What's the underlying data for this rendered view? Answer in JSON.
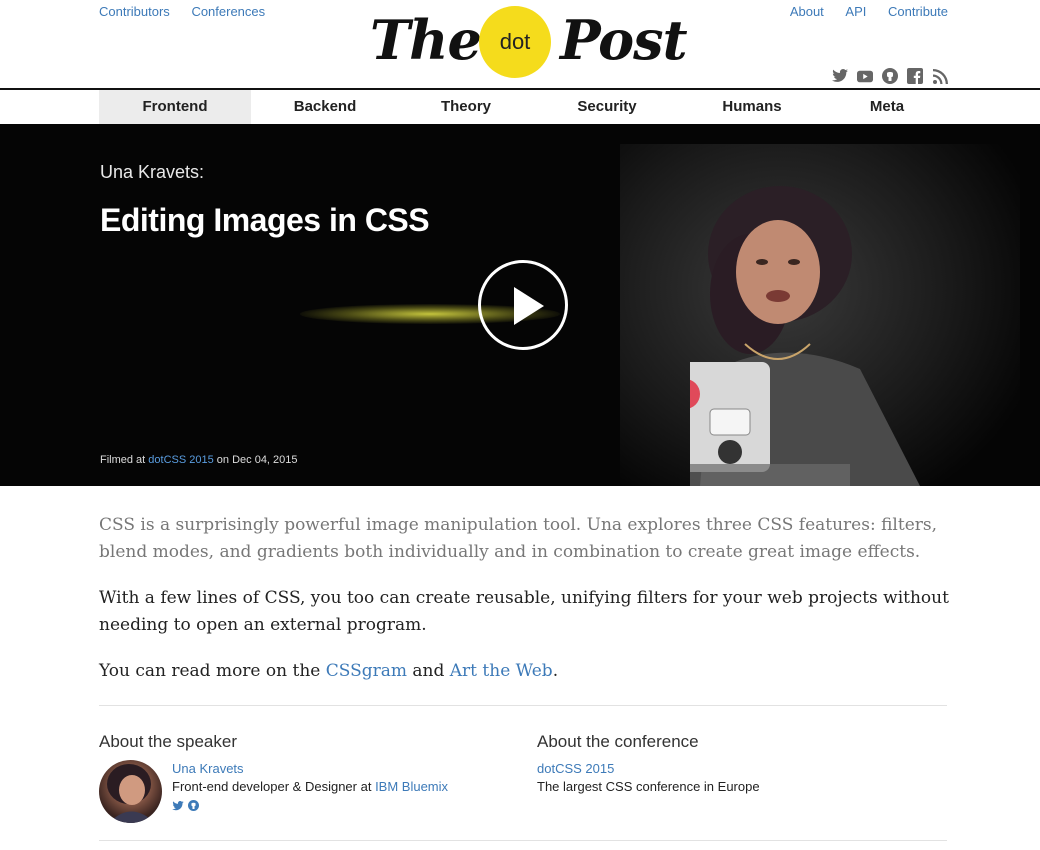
{
  "header": {
    "left_links": [
      "Contributors",
      "Conferences"
    ],
    "right_links": [
      "About",
      "API",
      "Contribute"
    ],
    "logo": {
      "word1": "The",
      "dot": "dot",
      "word2": "Post"
    },
    "social_icons": [
      "twitter-icon",
      "youtube-icon",
      "github-icon",
      "facebook-icon",
      "rss-icon"
    ]
  },
  "nav": {
    "items": [
      "Frontend",
      "Backend",
      "Theory",
      "Security",
      "Humans",
      "Meta"
    ],
    "active": "Frontend"
  },
  "hero": {
    "speaker": "Una Kravets:",
    "title": "Editing Images in CSS",
    "filmed_prefix": "Filmed at ",
    "filmed_event": "dotCSS 2015",
    "filmed_suffix": " on Dec 04, 2015"
  },
  "article": {
    "lead": "CSS is a surprisingly powerful image manipulation tool. Una explores three CSS features: filters, blend modes, and gradients both individually and in combination to create great image effects.",
    "p2": "With a few lines of CSS, you too can create reusable, unifying filters for your web projects without needing to open an external program.",
    "p3_prefix": "You can read more on the ",
    "p3_link1": "CSSgram",
    "p3_mid": " and ",
    "p3_link2": "Art the Web",
    "p3_suffix": "."
  },
  "about_speaker": {
    "heading": "About the speaker",
    "name": "Una Kravets",
    "role_prefix": "Front-end developer & Designer at ",
    "company": "IBM Bluemix"
  },
  "about_conference": {
    "heading": "About the conference",
    "name": "dotCSS 2015",
    "description": "The largest CSS conference in Europe"
  },
  "colors": {
    "accent": "#3d7ab8",
    "logo_dot": "#f5dc1c"
  }
}
